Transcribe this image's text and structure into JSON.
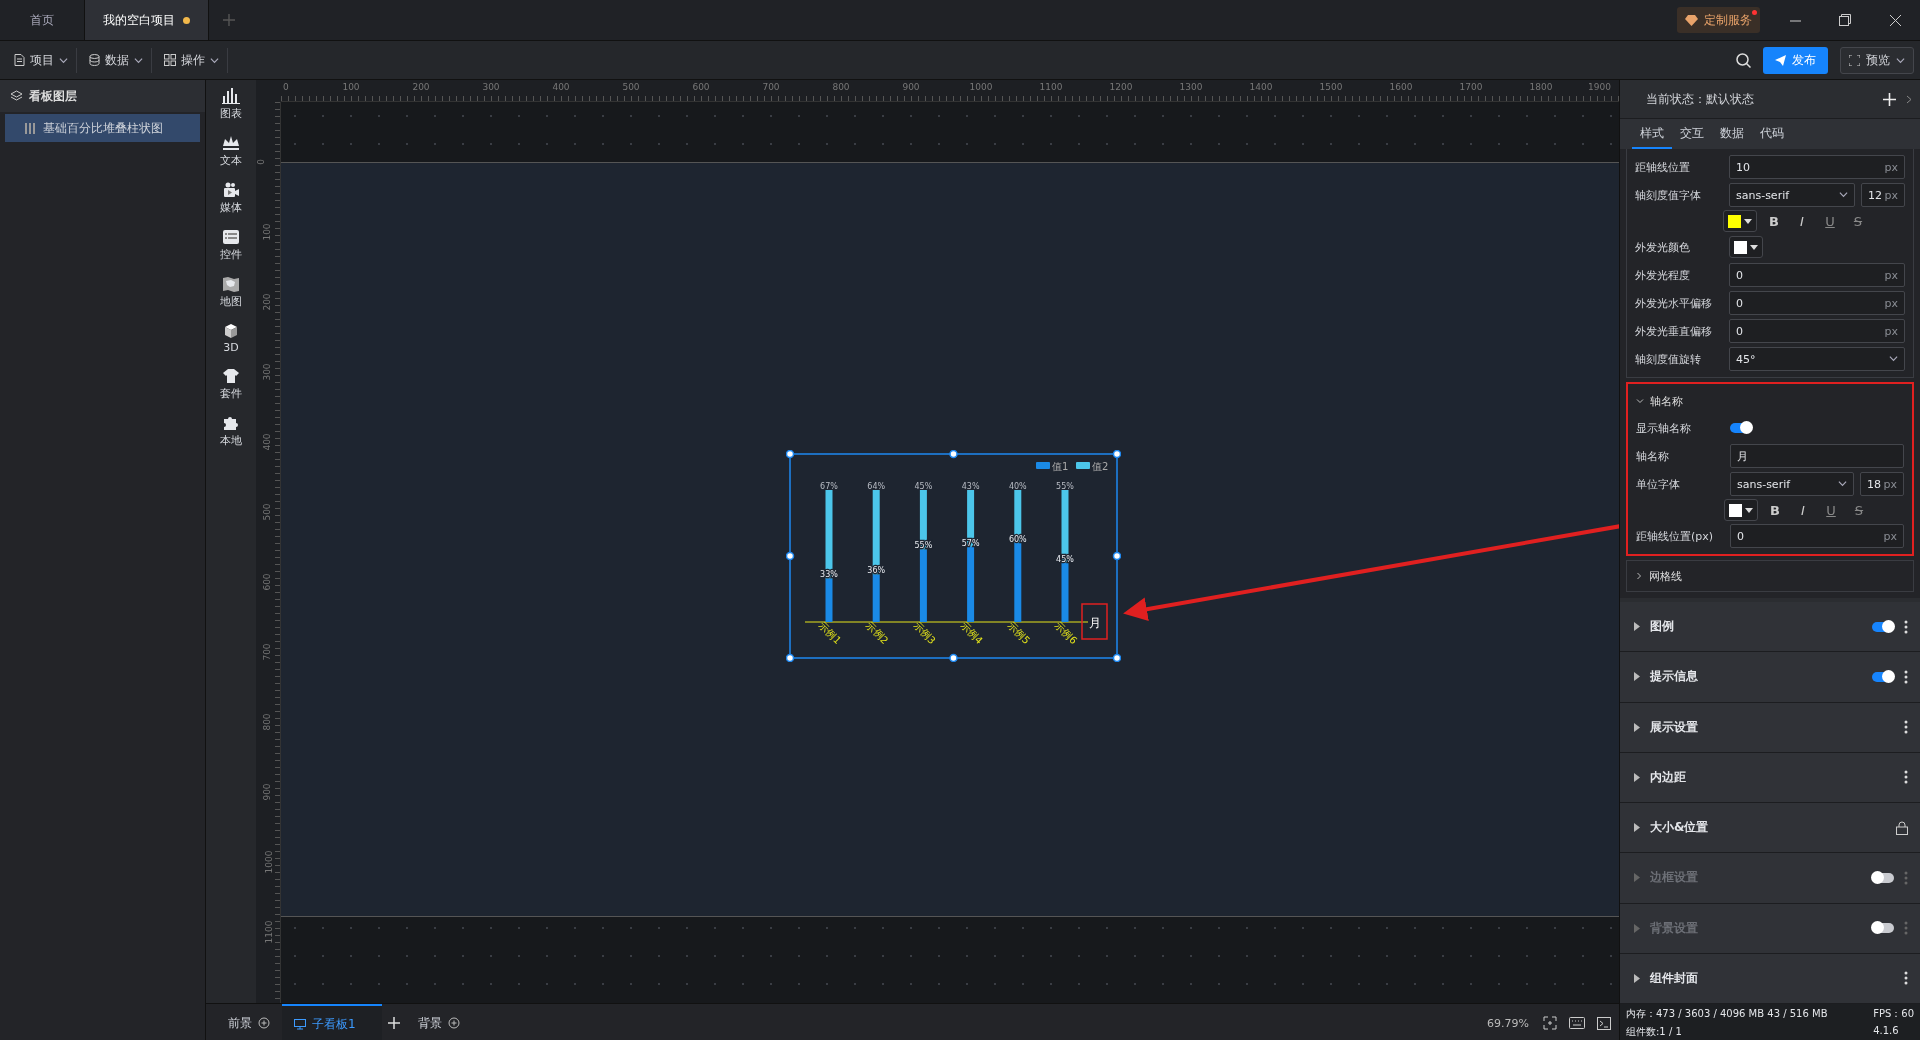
{
  "tabs": [
    {
      "label": "首页",
      "selected": false,
      "unsaved": false
    },
    {
      "label": "我的空白项目",
      "selected": true,
      "unsaved": true
    }
  ],
  "service": {
    "label": "定制服务",
    "notice": true
  },
  "toolbar": {
    "menus": [
      {
        "label": "项目",
        "kind": "file"
      },
      {
        "label": "数据",
        "kind": "database"
      },
      {
        "label": "操作",
        "kind": "grid"
      }
    ],
    "publish": "发布",
    "preview": "预览"
  },
  "layers": {
    "title": "看板图层",
    "items": [
      {
        "label": "基础百分比堆叠柱状图",
        "selected": true
      }
    ]
  },
  "components": [
    {
      "label": "图表",
      "kind": "chart"
    },
    {
      "label": "文本",
      "kind": "text"
    },
    {
      "label": "媒体",
      "kind": "media"
    },
    {
      "label": "控件",
      "kind": "control"
    },
    {
      "label": "地图",
      "kind": "map"
    },
    {
      "label": "3D",
      "kind": "cube"
    },
    {
      "label": "套件",
      "kind": "shirt"
    },
    {
      "label": "本地",
      "kind": "puzzle"
    }
  ],
  "rulers": {
    "horizontal": [
      "0",
      "100",
      "200",
      "300",
      "400",
      "500",
      "600",
      "700",
      "800",
      "900",
      "1000",
      "1100",
      "1200",
      "1300",
      "1400",
      "1500",
      "1600",
      "1700",
      "1800",
      "1900"
    ],
    "vertical": [
      "0",
      "100",
      "200",
      "300",
      "400",
      "500",
      "600",
      "700",
      "800",
      "900",
      "1000",
      "1100"
    ]
  },
  "chart": {
    "chart_data": {
      "type": "bar",
      "stacked": true,
      "legend": "upper right",
      "orientation": "vertical",
      "categories": [
        "示例1",
        "示例2",
        "示例3",
        "示例4",
        "示例5",
        "示例6"
      ],
      "xlabel": "月",
      "series": [
        {
          "name": "值1",
          "color": "#1a8ae6",
          "values": [
            0.33,
            0.36,
            0.55,
            0.57,
            0.6,
            0.45
          ],
          "value_labels": [
            "33%",
            "36%",
            "55%",
            "57%",
            "60%",
            "45%"
          ]
        },
        {
          "name": "值2",
          "color": "#4cc6ea",
          "values": [
            0.67,
            0.64,
            0.45,
            0.43,
            0.4,
            0.55
          ],
          "value_labels": [
            "67%",
            "64%",
            "45%",
            "43%",
            "40%",
            "55%"
          ]
        }
      ]
    }
  },
  "bottom_bar": {
    "tabs": [
      {
        "label": "前景",
        "selected": false,
        "kind": "layer"
      },
      {
        "label": "子看板1",
        "selected": true,
        "kind": "board"
      },
      {
        "label": "背景",
        "selected": false,
        "kind": "layer"
      }
    ],
    "zoom": "69.79%"
  },
  "panel": {
    "state_label": "当前状态：默认状态",
    "tabs": [
      {
        "label": "样式",
        "selected": true
      },
      {
        "label": "交互",
        "selected": false
      },
      {
        "label": "数据",
        "selected": false
      },
      {
        "label": "代码",
        "selected": false
      }
    ],
    "rows": [
      {
        "kind": "input",
        "label": "距轴线位置",
        "value": "10",
        "unit": "px"
      },
      {
        "kind": "font",
        "label": "轴刻度值字体",
        "font": "sans-serif",
        "size": "12",
        "unit": "px",
        "color": "#ffff00",
        "styles": [
          "B",
          "I",
          "U",
          "S"
        ]
      },
      {
        "kind": "color",
        "label": "外发光颜色",
        "color": "#ffffff"
      },
      {
        "kind": "input",
        "label": "外发光程度",
        "value": "0",
        "unit": "px"
      },
      {
        "kind": "input",
        "label": "外发光水平偏移",
        "value": "0",
        "unit": "px"
      },
      {
        "kind": "input",
        "label": "外发光垂直偏移",
        "value": "0",
        "unit": "px"
      },
      {
        "kind": "select",
        "label": "轴刻度值旋转",
        "value": "45°"
      }
    ],
    "axis_name": {
      "title": "轴名称",
      "expanded": true,
      "rows": [
        {
          "kind": "toggle",
          "label": "显示轴名称",
          "on": true
        },
        {
          "kind": "text",
          "label": "轴名称",
          "value": "月"
        },
        {
          "kind": "font",
          "label": "单位字体",
          "font": "sans-serif",
          "size": "18",
          "unit": "px",
          "color": "#ffffff",
          "styles": [
            "B",
            "I",
            "U",
            "S"
          ]
        },
        {
          "kind": "input",
          "label": "距轴线位置(px)",
          "value": "0",
          "unit": "px"
        }
      ]
    },
    "gridlines": {
      "title": "网格线",
      "expanded": false
    },
    "sections": [
      {
        "title": "图例",
        "kind": "toggle",
        "on": true,
        "disabled": false
      },
      {
        "title": "提示信息",
        "kind": "toggle",
        "on": true,
        "disabled": false
      },
      {
        "title": "展示设置",
        "kind": "plain",
        "disabled": false
      },
      {
        "title": "内边距",
        "kind": "plain",
        "disabled": false
      },
      {
        "title": "大小&位置",
        "kind": "lock",
        "disabled": false
      },
      {
        "title": "边框设置",
        "kind": "toggle",
        "on": false,
        "disabled": true
      },
      {
        "title": "背景设置",
        "kind": "toggle",
        "on": false,
        "disabled": true
      },
      {
        "title": "组件封面",
        "kind": "plain",
        "disabled": false
      }
    ]
  },
  "status": {
    "memory": "内存：473 / 3603 / 4096 MB  43 / 516 MB",
    "fps": "FPS：60",
    "components": "组件数:1 / 1",
    "version": "4.1.6"
  }
}
